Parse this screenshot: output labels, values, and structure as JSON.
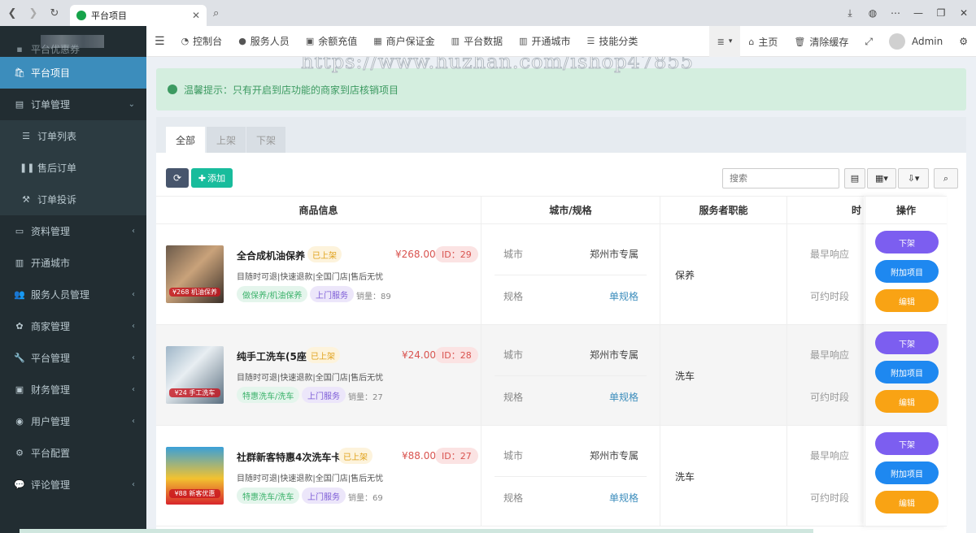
{
  "browser": {
    "tab_title": "平台项目"
  },
  "sidebar": {
    "partial_item": "平台优惠券",
    "items": [
      {
        "label": "平台项目",
        "icon": "bag-icon"
      },
      {
        "label": "订单管理",
        "icon": "list-icon"
      },
      {
        "label": "订单列表",
        "icon": "bars-icon"
      },
      {
        "label": "售后订单",
        "icon": "pause-icon"
      },
      {
        "label": "订单投诉",
        "icon": "gavel-icon"
      },
      {
        "label": "资料管理",
        "icon": "folder-icon"
      },
      {
        "label": "开通城市",
        "icon": "map-icon"
      },
      {
        "label": "服务人员管理",
        "icon": "users-icon"
      },
      {
        "label": "商家管理",
        "icon": "paw-icon"
      },
      {
        "label": "平台管理",
        "icon": "wrench-icon"
      },
      {
        "label": "财务管理",
        "icon": "inbox-icon"
      },
      {
        "label": "用户管理",
        "icon": "user-circle-icon"
      },
      {
        "label": "平台配置",
        "icon": "cogs-icon"
      },
      {
        "label": "评论管理",
        "icon": "comment-icon"
      }
    ]
  },
  "topnav": {
    "items": [
      "控制台",
      "服务人员",
      "余额充值",
      "商户保证金",
      "平台数据",
      "开通城市",
      "技能分类"
    ],
    "home": "主页",
    "clear_cache": "清除缓存",
    "user": "Admin"
  },
  "alert": {
    "text": "温馨提示：只有开启到店功能的商家到店核销项目"
  },
  "watermark": "https://www.huzhan.com/ishop47855",
  "tabs": [
    "全部",
    "上架",
    "下架"
  ],
  "toolbar": {
    "add_label": "添加",
    "search_placeholder": "搜索"
  },
  "table": {
    "headers": [
      "商品信息",
      "城市/规格",
      "服务者职能",
      "时",
      "操作"
    ],
    "rows": [
      {
        "name": "全合成机油保养",
        "status": "已上架",
        "price": "¥268.00",
        "id": "ID：29",
        "desc": "目随时可退|快速退款|全国门店|售后无忧",
        "tag1": "做保养/机油保养",
        "tag2": "上门服务",
        "sales": "销量：89",
        "city_label": "城市",
        "city": "郑州市专属",
        "spec_label": "规格",
        "spec": "单规格",
        "role": "保养",
        "t1": "最早响应",
        "t2": "可约时段",
        "thumb_text": "¥268 机油保养"
      },
      {
        "name": "纯手工洗车(5座",
        "status": "已上架",
        "price": "¥24.00",
        "id": "ID：28",
        "desc": "目随时可退|快速退款|全国门店|售后无忧",
        "tag1": "特惠洗车/洗车",
        "tag2": "上门服务",
        "sales": "销量：27",
        "city_label": "城市",
        "city": "郑州市专属",
        "spec_label": "规格",
        "spec": "单规格",
        "role": "洗车",
        "t1": "最早响应",
        "t2": "可约时段",
        "thumb_text": "¥24 手工洗车"
      },
      {
        "name": "社群新客特惠4次洗车卡",
        "status": "已上架",
        "price": "¥88.00",
        "id": "ID：27",
        "desc": "目随时可退|快速退款|全国门店|售后无忧",
        "tag1": "特惠洗车/洗车",
        "tag2": "上门服务",
        "sales": "销量：69",
        "city_label": "城市",
        "city": "郑州市专属",
        "spec_label": "规格",
        "spec": "单规格",
        "role": "洗车",
        "t1": "最早响应",
        "t2": "可约时段",
        "thumb_text": "¥88 新客优惠"
      }
    ],
    "actions": {
      "off": "下架",
      "attach": "附加项目",
      "edit": "编辑"
    }
  },
  "colors": {
    "sidebar_bg": "#222d32",
    "active": "#3c8dbc",
    "add_btn": "#18bc9c",
    "off_btn": "#7c5ef0",
    "attach_btn": "#1e88f0",
    "edit_btn": "#f9a314"
  }
}
